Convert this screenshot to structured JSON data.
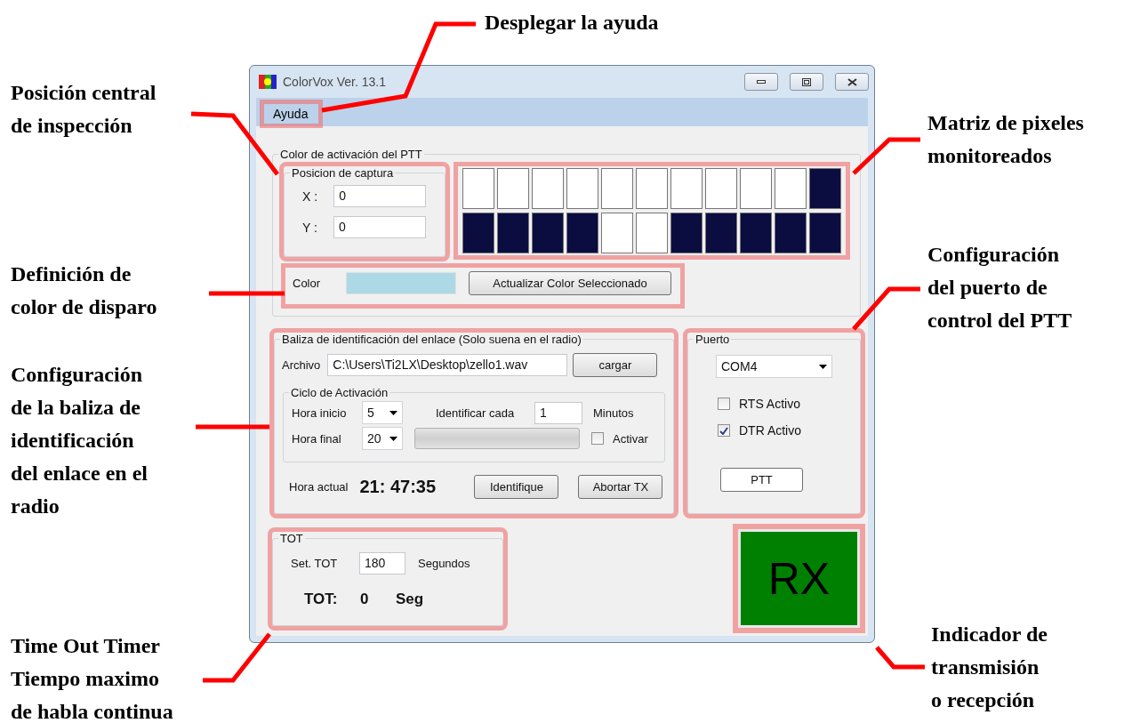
{
  "annotations": [
    {
      "text": "Desplegar la ayuda"
    },
    {
      "text": "Posición central\nde inspección"
    },
    {
      "text": "Matriz de pixeles\nmonitoreados"
    },
    {
      "text": "Definición de\ncolor de disparo"
    },
    {
      "text": "Configuración\ndel puerto de\ncontrol del PTT"
    },
    {
      "text": "Configuración\nde la baliza de\nidentificación\ndel enlace en el\nradio"
    },
    {
      "text": "Time Out Timer\nTiempo maximo\nde habla continua"
    },
    {
      "text": "Indicador de\ntransmisión\no recepción"
    }
  ],
  "window": {
    "title": "ColorVox Ver. 13.1"
  },
  "menu": [
    "Ayuda"
  ],
  "ptt_color": {
    "title": "Color de activación del PTT",
    "capture": {
      "title": "Posicion de captura",
      "x_label": "X :",
      "x_value": "0",
      "y_label": "Y :",
      "y_value": "0"
    },
    "pixel_rows": [
      [
        {
          "dark": false
        },
        {
          "dark": false
        },
        {
          "dark": false
        },
        {
          "dark": false
        },
        {
          "dark": false
        },
        {
          "dark": false
        },
        {
          "dark": false
        },
        {
          "dark": false
        },
        {
          "dark": false
        },
        {
          "dark": false
        },
        {
          "dark": true
        }
      ],
      [
        {
          "dark": true
        },
        {
          "dark": true
        },
        {
          "dark": true
        },
        {
          "dark": true
        },
        {
          "dark": false
        },
        {
          "dark": false
        },
        {
          "dark": true
        },
        {
          "dark": true
        },
        {
          "dark": true
        },
        {
          "dark": true
        },
        {
          "dark": true
        }
      ]
    ],
    "color_label": "Color",
    "color": "#add8e6",
    "update_button": "Actualizar Color Seleccionado"
  },
  "beacon": {
    "title": "Baliza de identificación del enlace (Solo suena en el radio)",
    "file_label": "Archivo",
    "file_value": "C:\\Users\\Ti2LX\\Desktop\\zello1.wav",
    "load_button": "cargar",
    "cycle": {
      "title": "Ciclo de Activación",
      "start_label": "Hora inicio",
      "start_value": "5",
      "end_label": "Hora final",
      "end_value": "20",
      "every_label": "Identificar cada",
      "every_value": "1",
      "unit": "Minutos",
      "progress": {
        "level": 0
      },
      "activate": {
        "label": "Activar",
        "checked": false
      }
    },
    "current_label": "Hora actual",
    "current_time": "21: 47:35",
    "buttons": [
      "Identifique",
      "Abortar TX"
    ]
  },
  "port": {
    "title": "Puerto",
    "value": "COM4",
    "checks": [
      {
        "label": "RTS Activo",
        "checked": false
      },
      {
        "label": "DTR Activo",
        "checked": true
      }
    ],
    "button": "PTT"
  },
  "tot": {
    "title": "TOT",
    "set_label": "Set. TOT",
    "set_value": "180",
    "unit": "Segundos",
    "counter_label": "TOT:",
    "counter_value": "0",
    "counter_unit": "Seg"
  },
  "indicator": {
    "label": "RX",
    "transmitting": false
  }
}
